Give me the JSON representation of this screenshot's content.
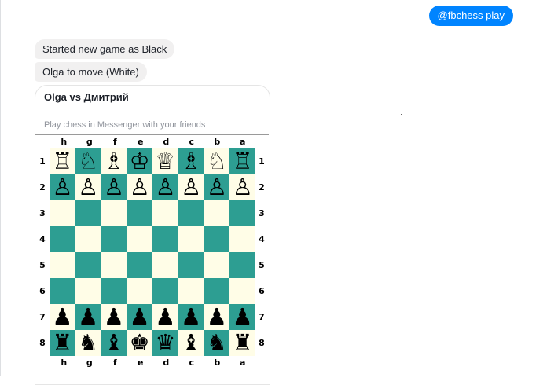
{
  "conversation": {
    "outgoing": [
      {
        "text": "@fbchess play"
      }
    ],
    "incoming": [
      {
        "text": "Started new game as Black"
      },
      {
        "text": "Olga to move (White)"
      }
    ]
  },
  "game_card": {
    "title": "Olga vs Дмитрий",
    "subtitle": "Play chess in Messenger with your friends",
    "board": {
      "files": [
        "h",
        "g",
        "f",
        "e",
        "d",
        "c",
        "b",
        "a"
      ],
      "ranks": [
        "1",
        "2",
        "3",
        "4",
        "5",
        "6",
        "7",
        "8"
      ],
      "light_square_color": "#fffde7",
      "dark_square_color": "#2d9e92",
      "rows": [
        [
          "♖",
          "♘",
          "♗",
          "♔",
          "♕",
          "♗",
          "♘",
          "♖"
        ],
        [
          "♙",
          "♙",
          "♙",
          "♙",
          "♙",
          "♙",
          "♙",
          "♙"
        ],
        [
          "",
          "",
          "",
          "",
          "",
          "",
          "",
          ""
        ],
        [
          "",
          "",
          "",
          "",
          "",
          "",
          "",
          ""
        ],
        [
          "",
          "",
          "",
          "",
          "",
          "",
          "",
          ""
        ],
        [
          "",
          "",
          "",
          "",
          "",
          "",
          "",
          ""
        ],
        [
          "♟",
          "♟",
          "♟",
          "♟",
          "♟",
          "♟",
          "♟",
          "♟"
        ],
        [
          "♜",
          "♞",
          "♝",
          "♚",
          "♛",
          "♝",
          "♞",
          "♜"
        ]
      ]
    }
  },
  "colors": {
    "outgoing_bubble": "#0084ff",
    "incoming_bubble": "#f1f0f0"
  }
}
